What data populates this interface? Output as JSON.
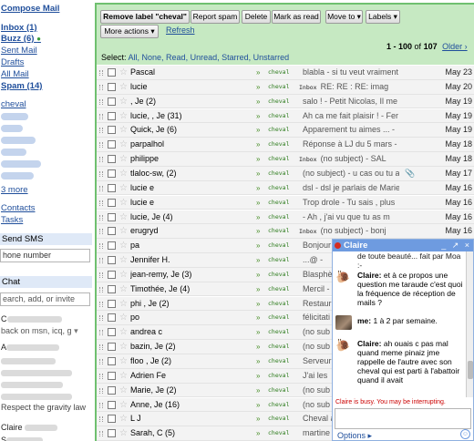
{
  "nav": {
    "compose": "Compose Mail",
    "inbox": "Inbox (1)",
    "buzz": "Buzz (6)",
    "sent": "Sent Mail",
    "drafts": "Drafts",
    "allmail": "All Mail",
    "spam": "Spam (14)",
    "label_cheval": "cheval",
    "more": "3 more",
    "contacts": "Contacts",
    "tasks": "Tasks"
  },
  "sms": {
    "header": "Send SMS",
    "placeholder": "hone number"
  },
  "chat_panel": {
    "header": "Chat",
    "search_placeholder": "earch, add, or invite",
    "status_line": "back on msn, icq, g",
    "contacts": [
      "C",
      "A",
      "",
      "",
      "",
      "",
      "Respect the gravity law",
      "Claire",
      "S"
    ]
  },
  "toolbar": {
    "remove_label": "Remove label \"cheval\"",
    "report_spam": "Report spam",
    "delete": "Delete",
    "mark_read": "Mark as read",
    "move_to": "Move to ▾",
    "labels": "Labels ▾",
    "more_actions": "More actions ▾",
    "refresh": "Refresh",
    "pager_range": "1 - 100",
    "pager_of": "of",
    "pager_total": "107",
    "older": "Older ›",
    "select_prefix": "Select:",
    "select_options": "All, None, Read, Unread, Starred, Unstarred"
  },
  "messages": [
    {
      "sender": "Pascal",
      "label": "cheval",
      "tag": "",
      "subject": "blabla - si tu veut vraiment",
      "date": "May 23"
    },
    {
      "sender": "lucie",
      "label": "cheval",
      "tag": "Inbox",
      "subject": "RE: RE : RE: imag",
      "date": "May 20"
    },
    {
      "sender": ", Je (2)",
      "label": "cheval",
      "tag": "",
      "subject": "salo ! - Petit Nicolas, Il me",
      "date": "May 19"
    },
    {
      "sender": "lucie, , Je (31)",
      "label": "cheval",
      "tag": "",
      "subject": "Ah ca me fait plaisir ! - Fer",
      "date": "May 19"
    },
    {
      "sender": "Quick, Je (6)",
      "label": "cheval",
      "tag": "",
      "subject": "Apparement tu aimes ... -",
      "date": "May 19"
    },
    {
      "sender": "parpalhol",
      "label": "cheval",
      "tag": "",
      "subject": "Réponse à LJ du 5 mars -",
      "date": "May 18"
    },
    {
      "sender": "philippe",
      "label": "cheval",
      "tag": "Inbox",
      "subject": "(no subject) - SAL",
      "date": "May 18"
    },
    {
      "sender": "tlaloc-sw, (2)",
      "label": "cheval",
      "tag": "",
      "subject": "(no subject) - u cas ou tu a",
      "date": "May 17"
    },
    {
      "sender": "lucie e",
      "label": "cheval",
      "tag": "",
      "subject": "dsl - dsl je parlais de Marie",
      "date": "May 16"
    },
    {
      "sender": "lucie e",
      "label": "cheval",
      "tag": "",
      "subject": "Trop drole - Tu sais , plus",
      "date": "May 16"
    },
    {
      "sender": "lucie, Je (4)",
      "label": "cheval",
      "tag": "",
      "subject": "- Ah , j'ai vu que tu as m",
      "date": "May 16"
    },
    {
      "sender": "erugryd",
      "label": "cheval",
      "tag": "Inbox",
      "subject": "(no subject) - bonj",
      "date": "May 16"
    },
    {
      "sender": "pa",
      "label": "cheval",
      "tag": "",
      "subject": "Bonjour",
      "date": ""
    },
    {
      "sender": "Jennifer H.",
      "label": "cheval",
      "tag": "",
      "subject": "...@ -",
      "date": ""
    },
    {
      "sender": "jean-remy, Je (3)",
      "label": "cheval",
      "tag": "",
      "subject": "Blasphè",
      "date": ""
    },
    {
      "sender": "Timothée, Je (4)",
      "label": "cheval",
      "tag": "",
      "subject": "Mercil -",
      "date": ""
    },
    {
      "sender": "phi , Je (2)",
      "label": "cheval",
      "tag": "",
      "subject": "Restaur",
      "date": ""
    },
    {
      "sender": "po",
      "label": "cheval",
      "tag": "",
      "subject": "félicitati",
      "date": ""
    },
    {
      "sender": "andrea c",
      "label": "cheval",
      "tag": "",
      "subject": "(no sub",
      "date": ""
    },
    {
      "sender": "bazin, Je (2)",
      "label": "cheval",
      "tag": "",
      "subject": "(no sub",
      "date": ""
    },
    {
      "sender": "floo , Je (2)",
      "label": "cheval",
      "tag": "",
      "subject": "Serveur",
      "date": ""
    },
    {
      "sender": "Adrien Fe",
      "label": "cheval",
      "tag": "",
      "subject": "J'ai les",
      "date": ""
    },
    {
      "sender": "Marie, Je (2)",
      "label": "cheval",
      "tag": "",
      "subject": "(no sub",
      "date": ""
    },
    {
      "sender": "Anne, Je (16)",
      "label": "cheval",
      "tag": "",
      "subject": "(no sub",
      "date": ""
    },
    {
      "sender": "L J",
      "label": "cheval",
      "tag": "",
      "subject": "Cheval a",
      "date": ""
    },
    {
      "sender": "Sarah, C (5)",
      "label": "cheval",
      "tag": "",
      "subject": "martine",
      "date": ""
    }
  ],
  "chatwin": {
    "title": "Claire",
    "controls": "_ ↗ ×",
    "line0": "de toute beauté... fait par Moa :-",
    "m1_name": "Claire:",
    "m1_text": "et à ce propos une question me taraude c'est quoi la fréquence de réception de mails ?",
    "m2_name": "me:",
    "m2_text": "1 à 2 par semaine.",
    "m3_name": "Claire:",
    "m3_text": "ah ouais c pas mal quand meme pinaiz jme rappelle de l'autre avec son cheval qui est parti à l'abattoir quand il avait",
    "busy": "Claire is busy. You may be interrupting.",
    "options": "Options ▸"
  }
}
